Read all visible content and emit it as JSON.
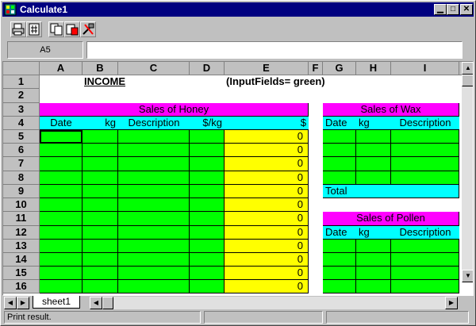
{
  "window": {
    "title": "Calculate1"
  },
  "namebox": {
    "value": "A5"
  },
  "formula": {
    "value": ""
  },
  "columns": [
    "A",
    "B",
    "C",
    "D",
    "E",
    "F",
    "G",
    "H",
    "I"
  ],
  "rows": [
    "1",
    "2",
    "3",
    "4",
    "5",
    "6",
    "7",
    "8",
    "9",
    "10",
    "11",
    "12",
    "13",
    "14",
    "15",
    "16"
  ],
  "cells": {
    "b1": "INCOME",
    "e1": "(InputFields= green)",
    "honey_title": "Sales of Honey",
    "honey_headers": [
      "Date",
      "kg",
      "Description",
      "$/kg",
      "$"
    ],
    "zero": "0",
    "wax_title": "Sales of Wax",
    "wax_headers": [
      "Date",
      "kg",
      "Description",
      "$"
    ],
    "total": "Total",
    "pollen_title": "Sales of Pollen",
    "pollen_headers": [
      "Date",
      "kg",
      "Description",
      "$"
    ]
  },
  "sheet_tab": "sheet1",
  "status": {
    "message": "Print result."
  },
  "colors": {
    "magenta": "#ff00ff",
    "cyan": "#00ffff",
    "green": "#00ff00",
    "yellow": "#ffff00"
  }
}
